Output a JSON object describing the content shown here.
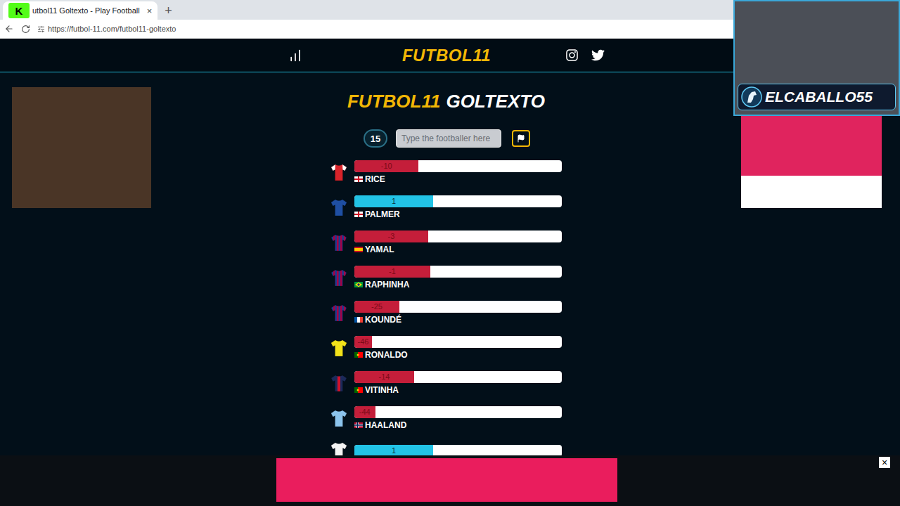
{
  "browser": {
    "logo": "K",
    "tab": {
      "title": "utbol11 Goltexto - Play Football",
      "close": "×",
      "selected": true
    },
    "new_tab": "+",
    "url": "https://futbol-11.com/futbol11-goltexto"
  },
  "header": {
    "logo": "FUTBOL11"
  },
  "game": {
    "title": [
      "FUTBOL11",
      "GOLTEXTO"
    ],
    "counter": "15",
    "input": {
      "placeholder": "Type the footballer here",
      "value": ""
    }
  },
  "guesses": [
    {
      "name": "RICE",
      "value": "-10",
      "level": 0.31,
      "trend": "down",
      "flag": "eng",
      "shirt": {
        "pattern": "plain",
        "color": "#d8232a",
        "accent": "#ffffff"
      }
    },
    {
      "name": "PALMER",
      "value": "1",
      "level": 0.38,
      "trend": "up",
      "flag": "eng",
      "shirt": {
        "pattern": "plain",
        "color": "#1f4fa3",
        "accent": "#1f4fa3"
      }
    },
    {
      "name": "YAMAL",
      "value": "-3",
      "level": 0.356,
      "trend": "down",
      "flag": "esp",
      "shirt": {
        "pattern": "stripes",
        "color": "#1d3c8f",
        "accent": "#a50044"
      }
    },
    {
      "name": "RAPHINHA",
      "value": "-1",
      "level": 0.366,
      "trend": "down",
      "flag": "bra",
      "shirt": {
        "pattern": "stripes",
        "color": "#1d3c8f",
        "accent": "#a50044"
      }
    },
    {
      "name": "KOUNDÉ",
      "value": "-25",
      "level": 0.217,
      "trend": "down",
      "flag": "fra",
      "shirt": {
        "pattern": "stripes",
        "color": "#1d3c8f",
        "accent": "#a50044"
      }
    },
    {
      "name": "RONALDO",
      "value": "-46",
      "level": 0.085,
      "trend": "down",
      "flag": "por",
      "shirt": {
        "pattern": "plain",
        "color": "#f2e21a",
        "accent": "#f2e21a"
      }
    },
    {
      "name": "VITINHA",
      "value": "-14",
      "level": 0.288,
      "trend": "down",
      "flag": "por",
      "shirt": {
        "pattern": "center",
        "color": "#1b2a5a",
        "accent": "#d0112b"
      }
    },
    {
      "name": "HAALAND",
      "value": "-44",
      "level": 0.1,
      "trend": "down",
      "flag": "nor",
      "shirt": {
        "pattern": "plain",
        "color": "#8cc4ec",
        "accent": "#8cc4ec"
      }
    },
    {
      "value": "1",
      "level": 0.38,
      "trend": "up",
      "shirt": {
        "pattern": "plain",
        "color": "#f4f4f4",
        "accent": "#f4f4f4"
      }
    }
  ],
  "streamer": {
    "name": "ELCABALLO55"
  },
  "ads": {
    "close": "×"
  }
}
